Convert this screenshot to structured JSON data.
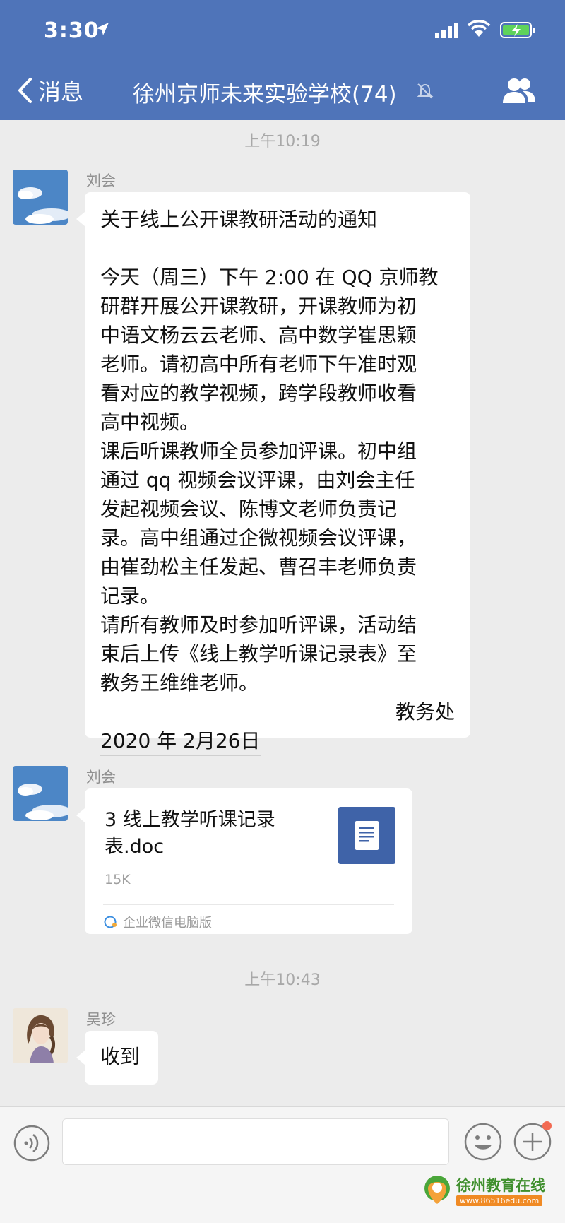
{
  "status_bar": {
    "time": "3:30"
  },
  "header": {
    "back_label": "消息",
    "title": "徐州京师未来实验学校(74)"
  },
  "messages": [
    {
      "timestamp": "上午10:19",
      "sender": "刘会",
      "text": "关于线上公开课教研活动的通知\n\n今天（周三）下午 2:00 在 QQ 京师教\n研群开展公开课教研，开课教师为初\n中语文杨云云老师、高中数学崔思颖\n老师。请初高中所有老师下午准时观\n看对应的教学视频，跨学段教师收看\n高中视频。\n课后听课教师全员参加评课。初中组\n通过 qq 视频会议评课，由刘会主任\n发起视频会议、陈博文老师负责记\n录。高中组通过企微视频会议评课，\n由崔劲松主任发起、曹召丰老师负责\n记录。\n请所有教师及时参加听评课，活动结\n束后上传《线上教学听课记录表》至\n教务王维维老师。",
      "signature": "教务处",
      "date": "2020 年 2月26日"
    },
    {
      "sender": "刘会",
      "file": {
        "name": "3 线上教学听课记录表.doc",
        "size": "15K",
        "source": "企业微信电脑版"
      }
    },
    {
      "timestamp": "上午10:43",
      "sender": "吴珍",
      "text": "收到"
    }
  ],
  "watermark": {
    "name": "徐州教育在线",
    "url": "www.86516edu.com"
  },
  "colors": {
    "header": "#4f74b9",
    "file_icon": "#3f63a8",
    "background": "#ececec"
  }
}
